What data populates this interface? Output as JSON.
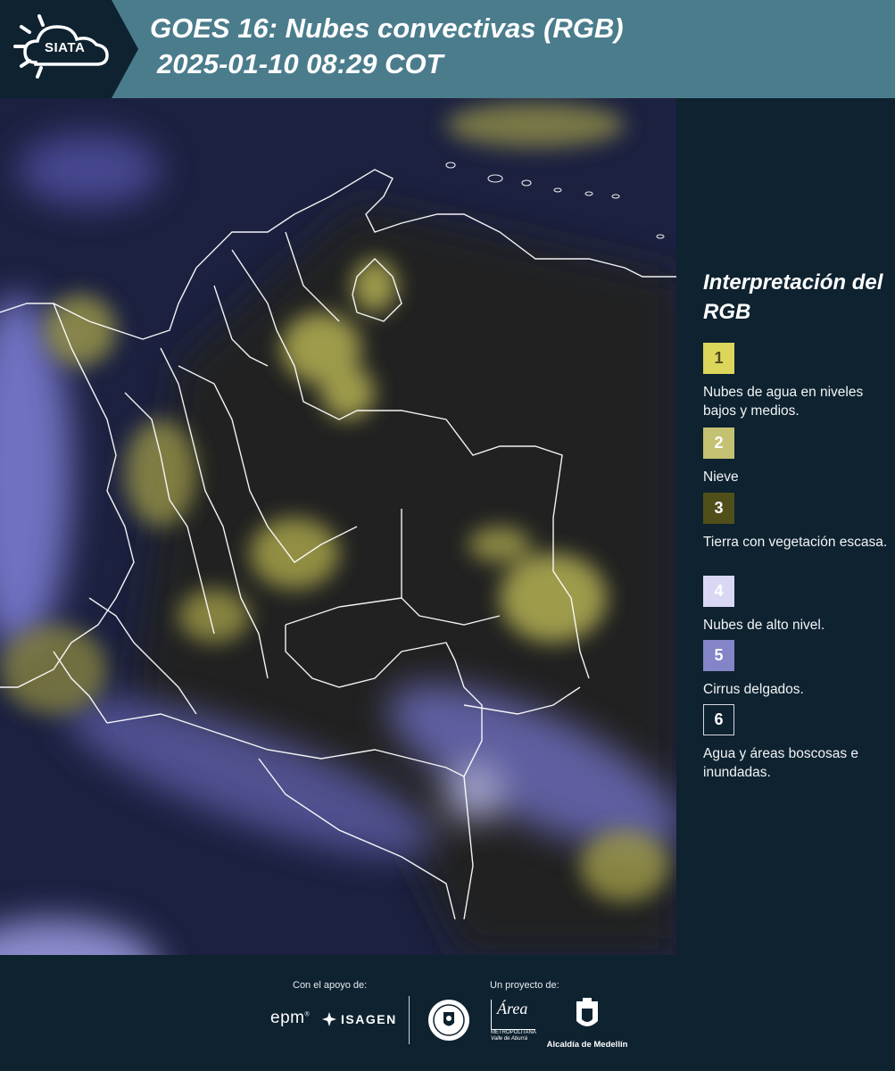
{
  "header": {
    "logo_text": "SIATA",
    "title_line1": "GOES 16: Nubes convectivas (RGB)",
    "title_line2": "2025-01-10 08:29 COT"
  },
  "legend": {
    "title": "Interpretación del RGB",
    "items": [
      {
        "number": "1",
        "text": "Nubes de agua en niveles bajos y medios.",
        "color": "#dcd65a",
        "number_color": "#4d4a1c"
      },
      {
        "number": "2",
        "text": "Nieve",
        "color": "#c4c172",
        "number_color": "#ffffff"
      },
      {
        "number": "3",
        "text": "Tierra con vegetación escasa.",
        "color": "#504f1a",
        "number_color": "#ffffff"
      },
      {
        "number": "4",
        "text": "Nubes de alto nivel.",
        "color": "#d8d8f4",
        "number_color": "#ffffff"
      },
      {
        "number": "5",
        "text": "Cirrus delgados.",
        "color": "#8484c8",
        "number_color": "#ffffff"
      },
      {
        "number": "6",
        "text": "Agua y áreas boscosas e inundadas.",
        "color": "#0e2230",
        "number_color": "#ffffff"
      }
    ]
  },
  "footer": {
    "support_label": "Con el apoyo de:",
    "project_label": "Un proyecto de:",
    "epm": "epm",
    "isagen": "ISAGEN",
    "area_name": "Área",
    "area_sub1": "METROPOLITANA",
    "area_sub2": "Valle de Aburrá",
    "alcaldia": "Alcaldía de Medellín"
  },
  "colors": {
    "header_bg": "#4a7c8c",
    "panel_bg": "#0e2230",
    "map_bg": "#1c2140"
  }
}
